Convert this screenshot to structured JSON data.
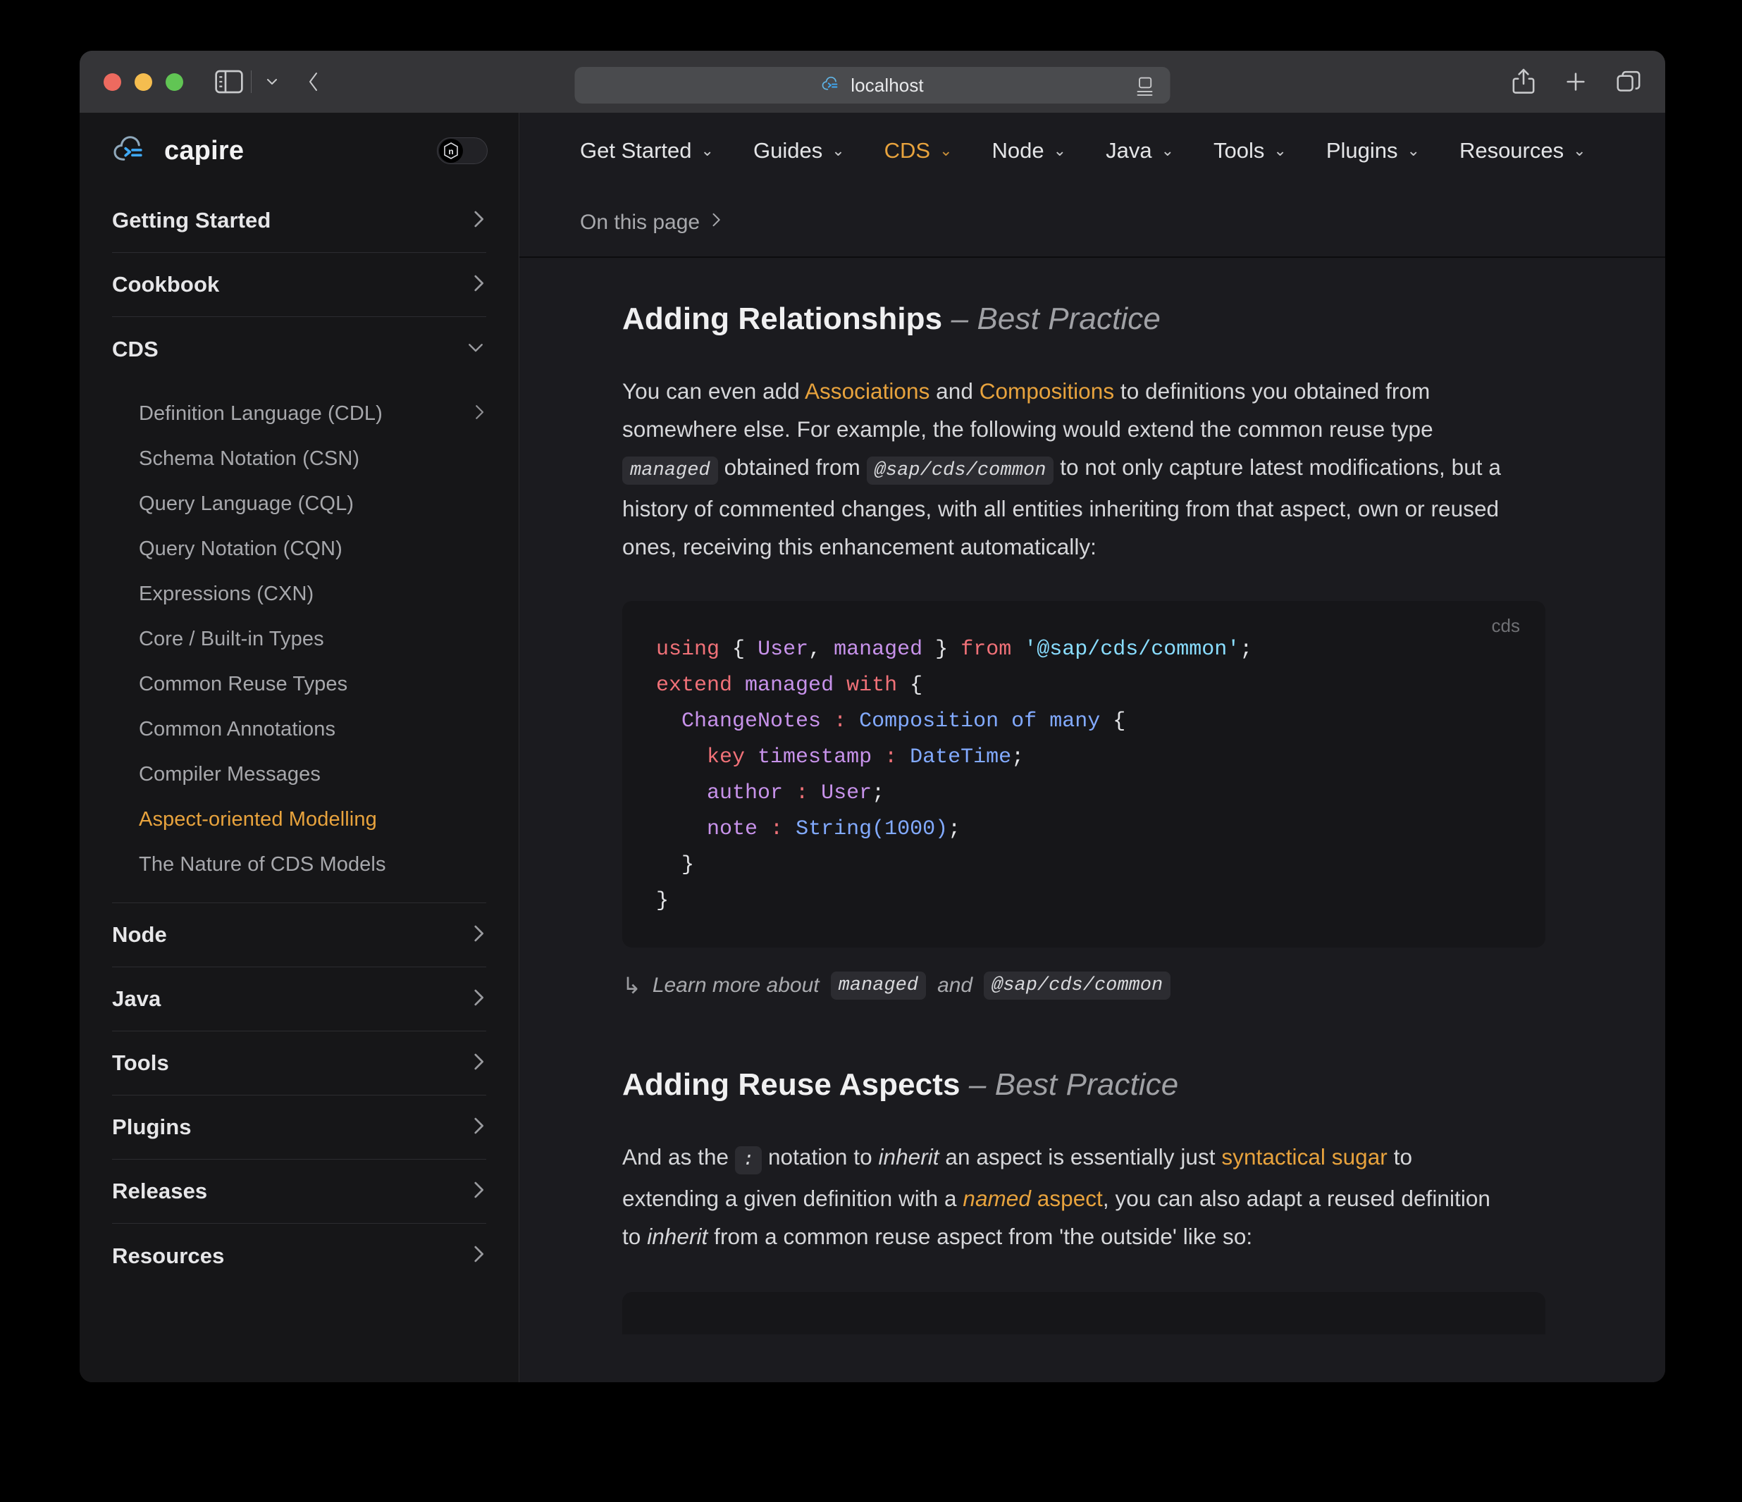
{
  "browser": {
    "url_text": "localhost",
    "icons": {
      "sidebar_toggle": "sidebar-toggle-icon",
      "sidebar_chevron": "chevron-down-icon",
      "back": "chevron-left-icon",
      "site_favicon": "capire-cloud-icon",
      "reader": "reader-mode-icon",
      "share": "share-icon",
      "new_tab": "plus-icon",
      "tabs": "tab-overview-icon"
    }
  },
  "sidebar": {
    "brand": "capire",
    "theme_toggle_badge": "n",
    "groups": [
      {
        "label": "Getting Started",
        "chevron": "›",
        "expanded": false
      },
      {
        "label": "Cookbook",
        "chevron": "›",
        "expanded": false
      },
      {
        "label": "CDS",
        "chevron": "⌄",
        "expanded": true
      }
    ],
    "cds_children": [
      {
        "label": "Definition Language (CDL)",
        "chevron": "›",
        "active": false
      },
      {
        "label": "Schema Notation (CSN)",
        "chevron": "",
        "active": false
      },
      {
        "label": "Query Language (CQL)",
        "chevron": "",
        "active": false
      },
      {
        "label": "Query Notation (CQN)",
        "chevron": "",
        "active": false
      },
      {
        "label": "Expressions (CXN)",
        "chevron": "",
        "active": false
      },
      {
        "label": "Core / Built-in Types",
        "chevron": "",
        "active": false
      },
      {
        "label": "Common Reuse Types",
        "chevron": "",
        "active": false
      },
      {
        "label": "Common Annotations",
        "chevron": "",
        "active": false
      },
      {
        "label": "Compiler Messages",
        "chevron": "",
        "active": false
      },
      {
        "label": "Aspect-oriented Modelling",
        "chevron": "",
        "active": true
      },
      {
        "label": "The Nature of CDS Models",
        "chevron": "",
        "active": false
      }
    ],
    "bottom_groups": [
      {
        "label": "Node",
        "chevron": "›"
      },
      {
        "label": "Java",
        "chevron": "›"
      },
      {
        "label": "Tools",
        "chevron": "›"
      },
      {
        "label": "Plugins",
        "chevron": "›"
      },
      {
        "label": "Releases",
        "chevron": "›"
      },
      {
        "label": "Resources",
        "chevron": "›"
      }
    ]
  },
  "topnav": {
    "items": [
      {
        "label": "Get Started",
        "chevron": "⌄",
        "active": false
      },
      {
        "label": "Guides",
        "chevron": "⌄",
        "active": false
      },
      {
        "label": "CDS",
        "chevron": "⌄",
        "active": true
      },
      {
        "label": "Node",
        "chevron": "⌄",
        "active": false
      },
      {
        "label": "Java",
        "chevron": "⌄",
        "active": false
      },
      {
        "label": "Tools",
        "chevron": "⌄",
        "active": false
      },
      {
        "label": "Plugins",
        "chevron": "⌄",
        "active": false
      },
      {
        "label": "Resources",
        "chevron": "⌄",
        "active": false
      }
    ]
  },
  "on_this_page": {
    "label": "On this page",
    "chevron": "›"
  },
  "doc": {
    "section1": {
      "title": "Adding Relationships",
      "title_sub": "– Best Practice",
      "para": {
        "t1": "You can even add ",
        "link1": "Associations",
        "t2": " and ",
        "link2": "Compositions",
        "t3": " to definitions you obtained from somewhere else. For example, the following would extend the common reuse type ",
        "code1": "managed",
        "t4": " obtained from ",
        "code2": "@sap/cds/common",
        "t5": " to not only capture latest modifications, but a history of commented changes, with all entities inheriting from that aspect, own or reused ones, receiving this enhancement automatically:"
      },
      "code": {
        "lang": "cds",
        "lines": [
          "using { User, managed } from '@sap/cds/common';",
          "extend managed with {",
          "  ChangeNotes : Composition of many {",
          "    key timestamp : DateTime;",
          "    author : User;",
          "    note : String(1000);",
          "  }",
          "}"
        ]
      },
      "learn_more": {
        "arrow": "↳",
        "t1": "Learn more about",
        "code1": "managed",
        "t2": "and",
        "code2": "@sap/cds/common"
      }
    },
    "section2": {
      "title": "Adding Reuse Aspects",
      "title_sub": "– Best Practice",
      "para": {
        "t1": "And as the ",
        "code1": ":",
        "t2": " notation to ",
        "em1": "inherit",
        "t3": " an aspect is essentially just ",
        "link1": "syntactical sugar",
        "t4": " to extending a given definition with a ",
        "link2_em": "named",
        "link2": " aspect",
        "t5": ", you can also adapt a reused definition to ",
        "em2": "inherit",
        "t6": " from a common reuse aspect from 'the outside' like so:"
      }
    }
  },
  "colors": {
    "accent": "#e8a33d",
    "window_bg": "#1b1b1f",
    "sidebar_bg": "#161618",
    "code_bg": "#161619",
    "titlebar_bg": "#353538"
  }
}
